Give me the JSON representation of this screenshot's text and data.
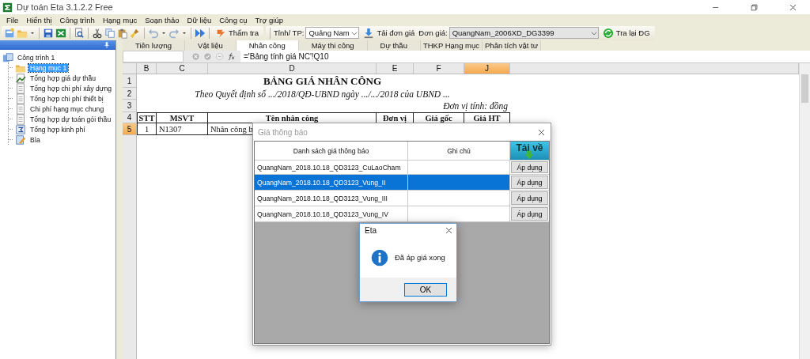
{
  "window": {
    "title": "Dự toán Eta 3.1.2.2 Free"
  },
  "menu": [
    "File",
    "Hiển thị",
    "Công trình",
    "Hạng mục",
    "Soạn thảo",
    "Dữ liệu",
    "Công cụ",
    "Trợ giúp"
  ],
  "toolbar": {
    "check_button": "Thẩm tra",
    "province_label": "Tỉnh/ TP:",
    "province": "Quảng Nam",
    "load_button": "Tải đơn giá",
    "price_label": "Đơn giá:",
    "price": "QuangNam_2006XD_DG3399",
    "reset_button": "Tra lại ĐG"
  },
  "tree": {
    "label": "Công trình 1",
    "selected": false,
    "children": [
      {
        "label": "Hạng mục 1",
        "kind": "folder",
        "selected": true
      },
      {
        "label": "Tổng hợp giá dự thầu",
        "kind": "report",
        "selected": false
      },
      {
        "label": "Tổng hợp chi phí xây dựng",
        "kind": "document",
        "selected": false
      },
      {
        "label": "Tổng hợp chi phí thiết bị",
        "kind": "document",
        "selected": false
      },
      {
        "label": "Chi phí hạng mục chung",
        "kind": "document",
        "selected": false
      },
      {
        "label": "Tổng hợp dự toán gói thầu",
        "kind": "document",
        "selected": false
      },
      {
        "label": "Tổng hợp kinh phí",
        "kind": "summary",
        "selected": false
      },
      {
        "label": "Bìa",
        "kind": "cover",
        "selected": false
      }
    ]
  },
  "sheet_tabs": [
    {
      "label": "Tiên lượng",
      "selected": false
    },
    {
      "label": "Vật liệu",
      "selected": false
    },
    {
      "label": "Nhân công",
      "selected": true
    },
    {
      "label": "Máy thi công",
      "selected": false
    },
    {
      "label": "Dự thầu",
      "selected": false
    },
    {
      "label": "THKP Hạng mục",
      "selected": false
    },
    {
      "label": "Phân tích vật tư",
      "selected": false
    }
  ],
  "formula_bar": {
    "formula": "='Bảng tính giá NC'!Q10"
  },
  "sheet": {
    "columns": [
      {
        "label": "B",
        "selected": false
      },
      {
        "label": "C",
        "selected": false
      },
      {
        "label": "D",
        "selected": false
      },
      {
        "label": "E",
        "selected": false
      },
      {
        "label": "F",
        "selected": false
      },
      {
        "label": "J",
        "selected": true
      }
    ],
    "row_numbers": [
      {
        "label": "1",
        "selected": false
      },
      {
        "label": "2",
        "selected": false
      },
      {
        "label": "3",
        "selected": false
      },
      {
        "label": "4",
        "selected": false
      },
      {
        "label": "5",
        "selected": true
      }
    ],
    "title": "BẢNG GIÁ NHÂN CÔNG",
    "subtitle": "Theo Quyết định số .../2018/QĐ-UBND ngày .../.../2018 của UBND ...",
    "unit": "Đơn vị tính: đồng",
    "header": [
      "STT",
      "MSVT",
      "Tên nhân công",
      "Đơn vị",
      "Giá gốc",
      "Giá HT"
    ],
    "rows": [
      [
        "1",
        "N1307",
        "Nhân công b"
      ]
    ]
  },
  "price_dialog": {
    "title": "Giá thông báo",
    "columns": [
      "Danh sách giá thông báo",
      "Ghi chú"
    ],
    "download_button": "Tải về",
    "rows": [
      {
        "name": "QuangNam_2018.10.18_QD3123_CuLaoCham",
        "button": "Áp dụng",
        "selected": false
      },
      {
        "name": "QuangNam_2018.10.18_QD3123_Vung_II",
        "button": "Áp dụng",
        "selected": true
      },
      {
        "name": "QuangNam_2018.10.18_QD3123_Vung_III",
        "button": "Áp dụng",
        "selected": false
      },
      {
        "name": "QuangNam_2018.10.18_QD3123_Vung_IV",
        "button": "Áp dụng",
        "selected": false
      }
    ]
  },
  "message_box": {
    "title": "Eta",
    "message": "Đã áp giá xong",
    "button": "OK"
  }
}
